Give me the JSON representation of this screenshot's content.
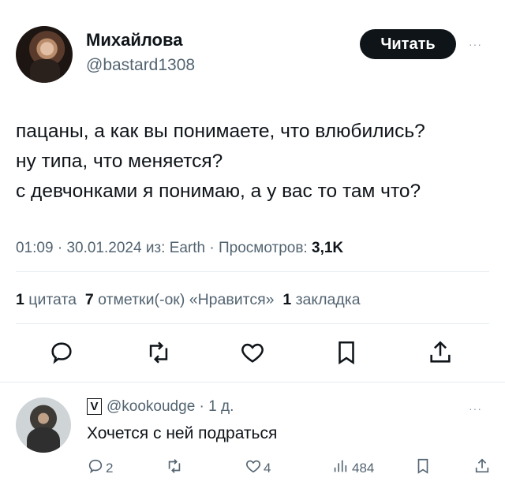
{
  "tweet": {
    "author_name": "Михайлова",
    "author_handle": "@bastard1308",
    "follow_label": "Читать",
    "more": "···",
    "text_lines": [
      "пацаны, а как вы понимаете, что влюбились?",
      "ну типа, что меняется?",
      "с девчонками я понимаю, а у вас то там что?"
    ],
    "time": "01:09",
    "date": "30.01.2024",
    "source": "из: Earth",
    "views_label": "Просмотров:",
    "views_value": "3,1K",
    "stats": {
      "quotes_count": "1",
      "quotes_label": "цитата",
      "retweets_count": "7",
      "retweets_label": "отметки(-ок) «Нравится»",
      "bookmarks_count": "1",
      "bookmarks_label": "закладка"
    }
  },
  "reply": {
    "badge": "V",
    "handle": "@kookoudge",
    "time": "1 д.",
    "more": "···",
    "text": "Хочется с ней подраться",
    "replies": "2",
    "likes": "4",
    "views": "484"
  },
  "icons": [
    "reply-icon",
    "retweet-icon",
    "like-icon",
    "bookmark-icon",
    "share-icon",
    "views-icon"
  ]
}
